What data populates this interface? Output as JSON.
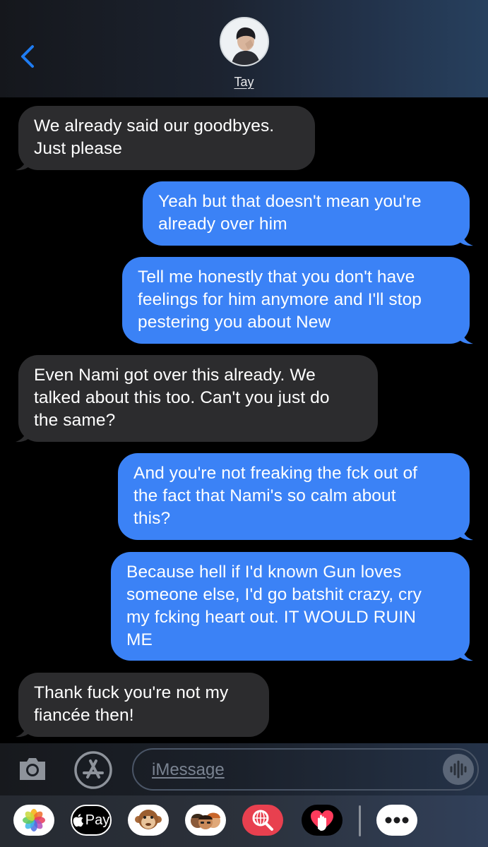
{
  "header": {
    "contact_name": "Tay"
  },
  "messages": [
    {
      "dir": "in",
      "text": "We already said our goodbyes.\nJust please"
    },
    {
      "dir": "out",
      "text": "Yeah but that doesn't mean you're\nalready over him"
    },
    {
      "dir": "out",
      "text": "Tell me honestly that you don't have\nfeelings for him anymore and I'll stop\npestering you about New"
    },
    {
      "dir": "in",
      "text": "Even Nami got over this already. We\ntalked about this too. Can't you just do\nthe same?"
    },
    {
      "dir": "out",
      "text": "And you're not freaking the fck out of\nthe fact that Nami's so calm about\nthis?"
    },
    {
      "dir": "out",
      "text": "Because hell if I'd known Gun loves\nsomeone else, I'd go batshit crazy, cry\nmy fcking heart out. IT WOULD RUIN\nME"
    },
    {
      "dir": "in",
      "text": "Thank fuck you're not my\nfiancée then!"
    }
  ],
  "compose": {
    "placeholder": "iMessage"
  },
  "drawer": {
    "apple_pay_label": "Pay",
    "apps": [
      "photos-icon",
      "apple-pay-icon",
      "monkey-animoji-icon",
      "memoji-icon",
      "image-search-icon",
      "digital-touch-icon",
      "more-icon"
    ]
  },
  "colors": {
    "incoming": "#2c2c2e",
    "outgoing": "#3b82f6",
    "accent": "#1f7cf2"
  }
}
